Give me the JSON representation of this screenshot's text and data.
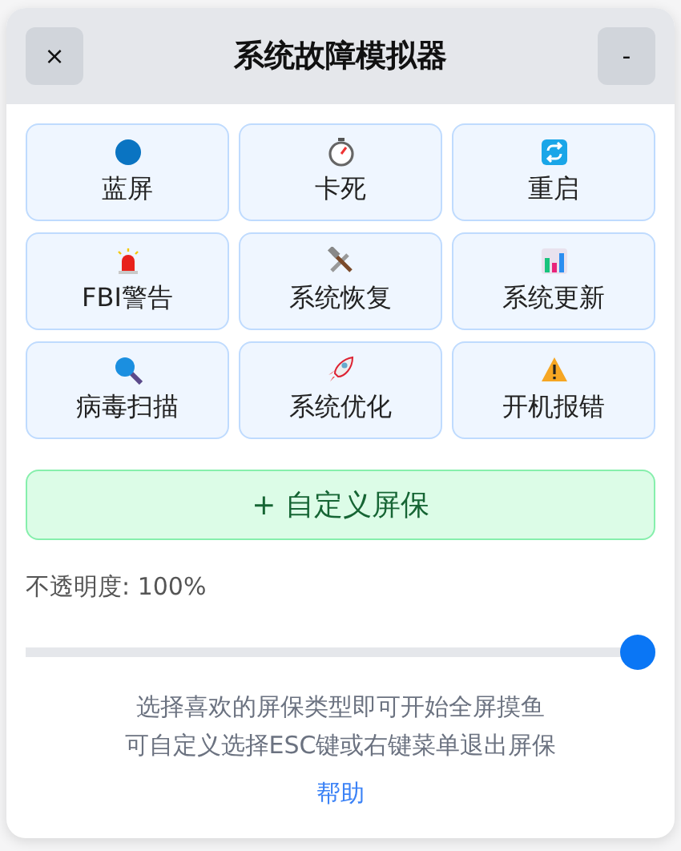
{
  "window": {
    "title": "系统故障模拟器",
    "close_button": "×",
    "minimize_button": "-"
  },
  "screensavers": [
    {
      "label": "蓝屏"
    },
    {
      "label": "卡死"
    },
    {
      "label": "重启"
    },
    {
      "label": "FBI警告"
    },
    {
      "label": "系统恢复"
    },
    {
      "label": "系统更新"
    },
    {
      "label": "病毒扫描"
    },
    {
      "label": "系统优化"
    },
    {
      "label": "开机报错"
    }
  ],
  "custom_button": "+ 自定义屏保",
  "opacity": {
    "label": "不透明度: 100%",
    "level": 1
  },
  "hints": [
    "选择喜欢的屏保类型即可开始全屏摸鱼",
    "可自定义选择ESC键或右键菜单退出屏保"
  ],
  "help_link": "帮助"
}
